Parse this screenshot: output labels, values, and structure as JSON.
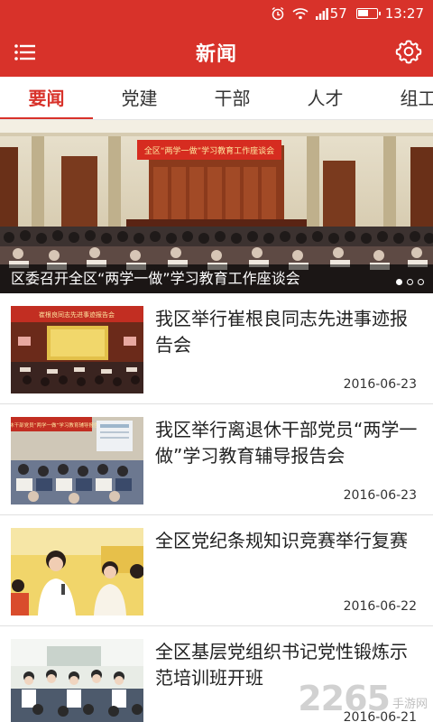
{
  "status_bar": {
    "signal": "57",
    "time": "13:27"
  },
  "app_bar": {
    "title": "新闻",
    "menu_icon": "list-menu-icon",
    "settings_icon": "gear-icon"
  },
  "tabs": [
    {
      "label": "要闻",
      "active": true
    },
    {
      "label": "党建",
      "active": false
    },
    {
      "label": "干部",
      "active": false
    },
    {
      "label": "人才",
      "active": false
    },
    {
      "label": "组工",
      "active": false
    }
  ],
  "banner": {
    "caption": "区委召开全区“两学一做”学习教育工作座谈会",
    "stage_banner_text": "全区“两学一做”学习教育工作座谈会",
    "dots": 3,
    "active_dot": 0
  },
  "news": [
    {
      "title": "我区举行崔根良同志先进事迹报告会",
      "date": "2016-06-23",
      "thumb_text": "崔根良同志先进事迹报告会"
    },
    {
      "title": "我区举行离退休干部党员“两学一做”学习教育辅导报告会",
      "date": "2016-06-23",
      "thumb_text": "离退休干部党员“两学一做”学习教育辅导报告会"
    },
    {
      "title": "全区党纪条规知识竞赛举行复赛",
      "date": "2016-06-22"
    },
    {
      "title": "全区基层党组织书记党性锻炼示范培训班开班",
      "date": "2016-06-21"
    }
  ],
  "watermark": {
    "number": "2265",
    "suffix": "手游网"
  },
  "colors": {
    "brand_red": "#d8322a",
    "text_dark": "#222222",
    "divider": "#e0e0e0"
  }
}
